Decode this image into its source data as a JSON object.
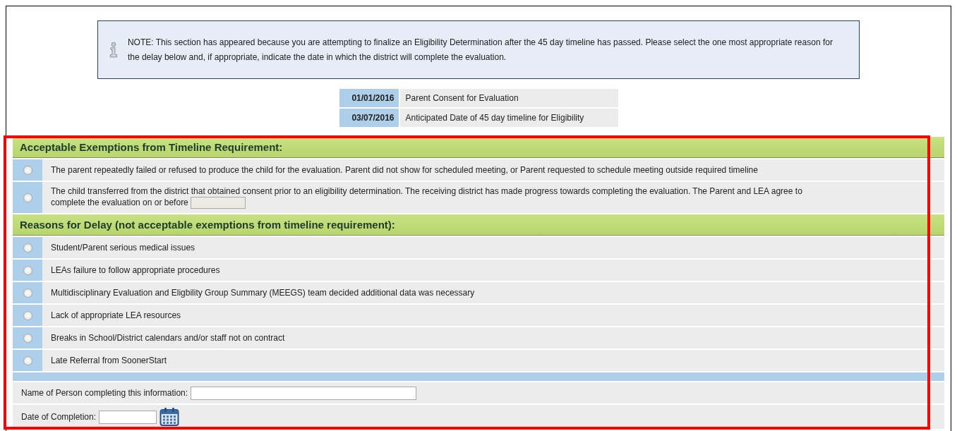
{
  "note": {
    "text": "NOTE: This section has appeared because you are attempting to finalize an Eligibility Determination after the 45 day timeline has passed. Please select the one most appropriate reason for the delay below and, if appropriate, indicate the date in which the district will complete the evaluation."
  },
  "dates": [
    {
      "date": "01/01/2016",
      "label": "Parent Consent for Evaluation"
    },
    {
      "date": "03/07/2016",
      "label": "Anticipated Date of 45 day timeline for Eligibility"
    }
  ],
  "sections": [
    {
      "title": "Acceptable Exemptions from Timeline Requirement:",
      "options": [
        {
          "kind": "plain",
          "text": "The parent repeatedly failed or refused to produce the child for the evaluation. Parent did not show for scheduled meeting, or Parent requested to schedule meeting outside required timeline",
          "selected": false
        },
        {
          "kind": "with-date",
          "text": "The child transferred from the district that obtained consent prior to an eligibility determination. The receiving district has made progress towards completing the evaluation. The Parent and LEA agree to",
          "date_label": "complete the evaluation on or before",
          "selected": false
        }
      ]
    },
    {
      "title": "Reasons for Delay (not acceptable exemptions from timeline requirement):",
      "options": [
        {
          "kind": "plain",
          "text": "Student/Parent serious medical issues",
          "selected": false
        },
        {
          "kind": "plain",
          "text": "LEAs failure to follow appropriate procedures",
          "selected": false
        },
        {
          "kind": "plain",
          "text": "Multidisciplinary Evaluation and Eligbility Group Summary (MEEGS) team decided additional data was necessary",
          "selected": false
        },
        {
          "kind": "plain",
          "text": "Lack of appropriate LEA resources",
          "selected": false
        },
        {
          "kind": "plain",
          "text": "Breaks in School/District calendars and/or staff not on contract",
          "selected": false
        },
        {
          "kind": "plain",
          "text": "Late Referral from SoonerStart",
          "selected": false
        }
      ]
    }
  ],
  "fields": [
    {
      "kind": "text",
      "label": "Name of Person completing this information:"
    },
    {
      "kind": "date",
      "label": "Date of Completion:"
    }
  ]
}
